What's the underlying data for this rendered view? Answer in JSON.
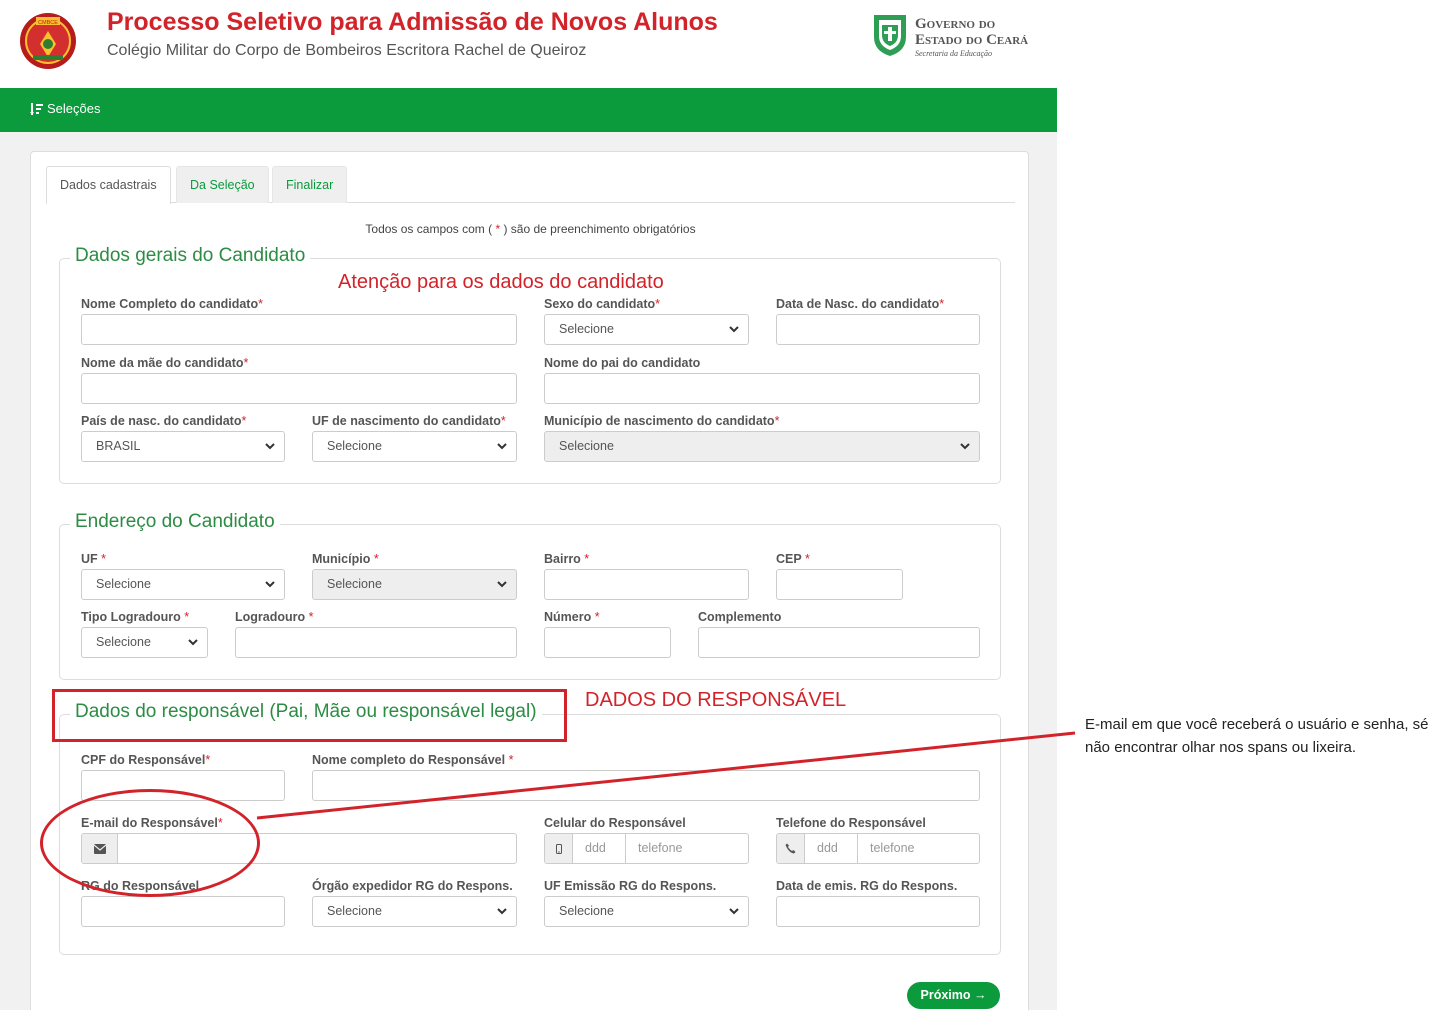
{
  "header": {
    "title": "Processo Seletivo para Admissão de Novos Alunos",
    "subtitle": "Colégio Militar do Corpo de Bombeiros Escritora Rachel de Queiroz",
    "logo_text": "CMBCE",
    "gov_line1": "Governo do",
    "gov_line2": "Estado do Ceará",
    "gov_sub": "Secretaria da Educação"
  },
  "nav": {
    "item": "Seleções"
  },
  "tabs": [
    "Dados cadastrais",
    "Da Seleção",
    "Finalizar"
  ],
  "required_note": {
    "before": "Todos os campos com ( ",
    "star": "*",
    "after": " ) são de preenchimento obrigatórios"
  },
  "sections": {
    "candidato": {
      "legend": "Dados gerais do Candidato",
      "nome": "Nome Completo do candidato",
      "sexo": "Sexo do candidato",
      "sexo_value": "Selecione",
      "nasc": "Data de Nasc. do candidato",
      "mae": "Nome da mãe do candidato",
      "pai": "Nome do pai do candidato",
      "pais": "País de nasc. do candidato",
      "pais_value": "BRASIL",
      "uf": "UF de nascimento do candidato",
      "uf_value": "Selecione",
      "municipio": "Município de nascimento do candidato",
      "municipio_value": "Selecione"
    },
    "endereco": {
      "legend": "Endereço do Candidato",
      "uf": "UF ",
      "uf_value": "Selecione",
      "municipio": "Município ",
      "municipio_value": "Selecione",
      "bairro": "Bairro ",
      "cep": "CEP ",
      "tipo": "Tipo Logradouro ",
      "tipo_value": "Selecione",
      "logradouro": "Logradouro ",
      "numero": "Número ",
      "complemento": "Complemento"
    },
    "responsavel": {
      "legend": "Dados do responsável (Pai, Mãe ou responsável legal)",
      "cpf": "CPF do Responsável",
      "nome": "Nome completo do Responsável ",
      "email": "E-mail do Responsável",
      "celular": "Celular do Responsável",
      "telefone": "Telefone do Responsável",
      "ph_ddd": "ddd",
      "ph_telefone": "telefone",
      "rg": "RG do Responsável",
      "orgao": "Órgão expedidor RG do Respons.",
      "orgao_value": "Selecione",
      "uf_rg": "UF Emissão RG do Respons.",
      "uf_rg_value": "Selecione",
      "data_rg": "Data de emis. RG do Respons."
    }
  },
  "req_star": "*",
  "buttons": {
    "next": "Próximo →"
  },
  "annotations": {
    "atencao": "Atenção para os dados do candidato",
    "dados_resp": "DADOS DO RESPONSÁVEL",
    "side_note": "E-mail em que você receberá o usuário e senha, sé não encontrar olhar nos spans ou lixeira."
  },
  "colors": {
    "brand_green": "#0b9a3c",
    "title_red": "#d2232a",
    "legend_green": "#2c8c44"
  },
  "icons": [
    "list-icon",
    "chevron-down-icon",
    "envelope-icon",
    "mobile-icon",
    "phone-icon"
  ]
}
